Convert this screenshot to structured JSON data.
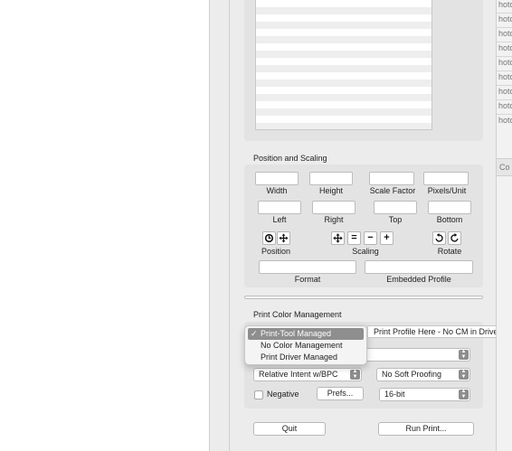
{
  "position_scaling": {
    "section_label": "Position and Scaling",
    "row1": [
      "Width",
      "Height",
      "Scale Factor",
      "Pixels/Unit"
    ],
    "row2": [
      "Left",
      "Right",
      "Top",
      "Bottom"
    ],
    "position_label": "Position",
    "scaling_label": "Scaling",
    "rotate_label": "Rotate",
    "scaling_buttons": [
      "=",
      "−",
      "+"
    ],
    "format_label": "Format",
    "embedded_profile_label": "Embedded Profile"
  },
  "color_management": {
    "section_label": "Print Color Management",
    "menu_items": [
      "Print-Tool Managed",
      "No Color Management",
      "Print Driver Managed"
    ],
    "selected_index": 0,
    "check_glyph": "✓",
    "profile_tooltip": "Print Profile Here - No CM in Driver",
    "rendering_intent": "Relative Intent w/BPC",
    "soft_proofing": "No Soft Proofing",
    "negative_label": "Negative",
    "prefs_button": "Prefs...",
    "bit_depth": "16-bit"
  },
  "footer": {
    "quit_button": "Quit",
    "run_print_button": "Run Print..."
  },
  "right_strip": {
    "items": [
      "hoto",
      "hoto",
      "hoto",
      "hoto",
      "hoto",
      "hoto",
      "hoto",
      "hoto",
      "hoto"
    ],
    "header": "Co"
  },
  "icons": {
    "position": [
      "target-icon",
      "move-arrows-icon"
    ],
    "scaling": [
      "expand-arrows-icon"
    ],
    "rotate": [
      "rotate-left-icon",
      "rotate-right-icon"
    ],
    "popup": "updown-chevron-icon"
  }
}
